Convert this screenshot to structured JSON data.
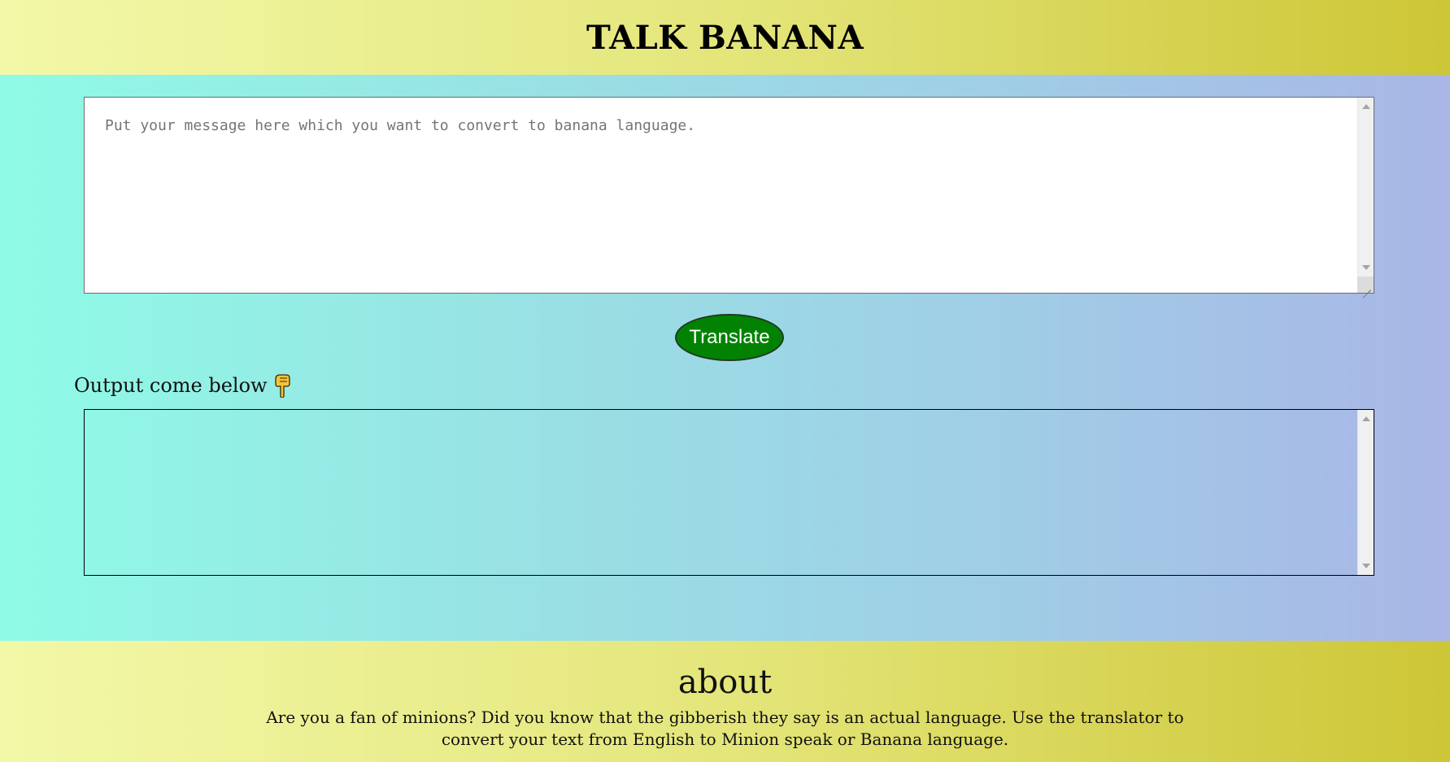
{
  "header": {
    "title": "TALK BANANA"
  },
  "input": {
    "placeholder": "Put your message here which you want to convert to banana language.",
    "value": ""
  },
  "translate_button": {
    "label": "Translate",
    "color": "#028203"
  },
  "output": {
    "label": "Output come below",
    "label_icon": "pointing-hand-down-icon",
    "value": ""
  },
  "footer": {
    "heading": "about",
    "text": "Are you a fan of minions? Did you know that the gibberish they say is an actual language. Use the translator to convert your text from English to Minion speak or Banana language."
  },
  "colors": {
    "header_gradient": [
      "#f3f8a8",
      "#cdc636"
    ],
    "body_gradient": [
      "#8ffbe6",
      "#a9b6e6"
    ]
  }
}
